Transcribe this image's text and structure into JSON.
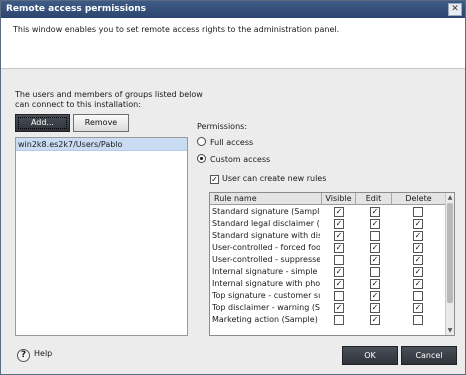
{
  "window": {
    "title": "Remote access permissions",
    "description": "This window enables you to set remote access rights to the administration panel.",
    "close_glyph": "✕"
  },
  "users": {
    "label_line1": "The users and members of groups listed below",
    "label_line2": "can connect to this installation:",
    "add_label": "Add...",
    "remove_label": "Remove",
    "items": [
      "win2k8.es2k7/Users/Pablo"
    ]
  },
  "permissions": {
    "label": "Permissions:",
    "full_access": "Full access",
    "custom_access": "Custom access",
    "selected": "custom",
    "create_rules_label": "User can create new rules",
    "create_rules_checked": true,
    "columns": [
      "Rule name",
      "Visible",
      "Edit",
      "Delete"
    ],
    "rules": [
      {
        "name": "Standard signature (Sample)",
        "visible": true,
        "edit": true,
        "delete": false
      },
      {
        "name": "Standard legal disclaimer (S",
        "visible": true,
        "edit": true,
        "delete": true
      },
      {
        "name": "Standard signature with discl",
        "visible": true,
        "edit": false,
        "delete": true
      },
      {
        "name": "User-controlled - forced foot",
        "visible": true,
        "edit": true,
        "delete": true
      },
      {
        "name": "User-controlled - suppressed",
        "visible": false,
        "edit": true,
        "delete": true
      },
      {
        "name": "Internal signature - simple (S",
        "visible": true,
        "edit": false,
        "delete": true
      },
      {
        "name": "Internal signature with photo",
        "visible": true,
        "edit": true,
        "delete": true
      },
      {
        "name": "Top signature - customer su",
        "visible": false,
        "edit": true,
        "delete": false
      },
      {
        "name": "Top disclaimer - warning (Sa",
        "visible": true,
        "edit": true,
        "delete": true
      },
      {
        "name": "Marketing action (Sample)",
        "visible": false,
        "edit": true,
        "delete": false
      }
    ]
  },
  "footer": {
    "help_label": "Help",
    "ok_label": "OK",
    "cancel_label": "Cancel"
  },
  "icons": {
    "help": "help-icon",
    "check": "checkmark-icon",
    "scroll_up": "chevron-up-icon",
    "scroll_down": "chevron-down-icon"
  },
  "colors": {
    "titlebar": "#2c4670",
    "selected_row": "#c9dcf3",
    "primary_button": "#3a3f47"
  }
}
